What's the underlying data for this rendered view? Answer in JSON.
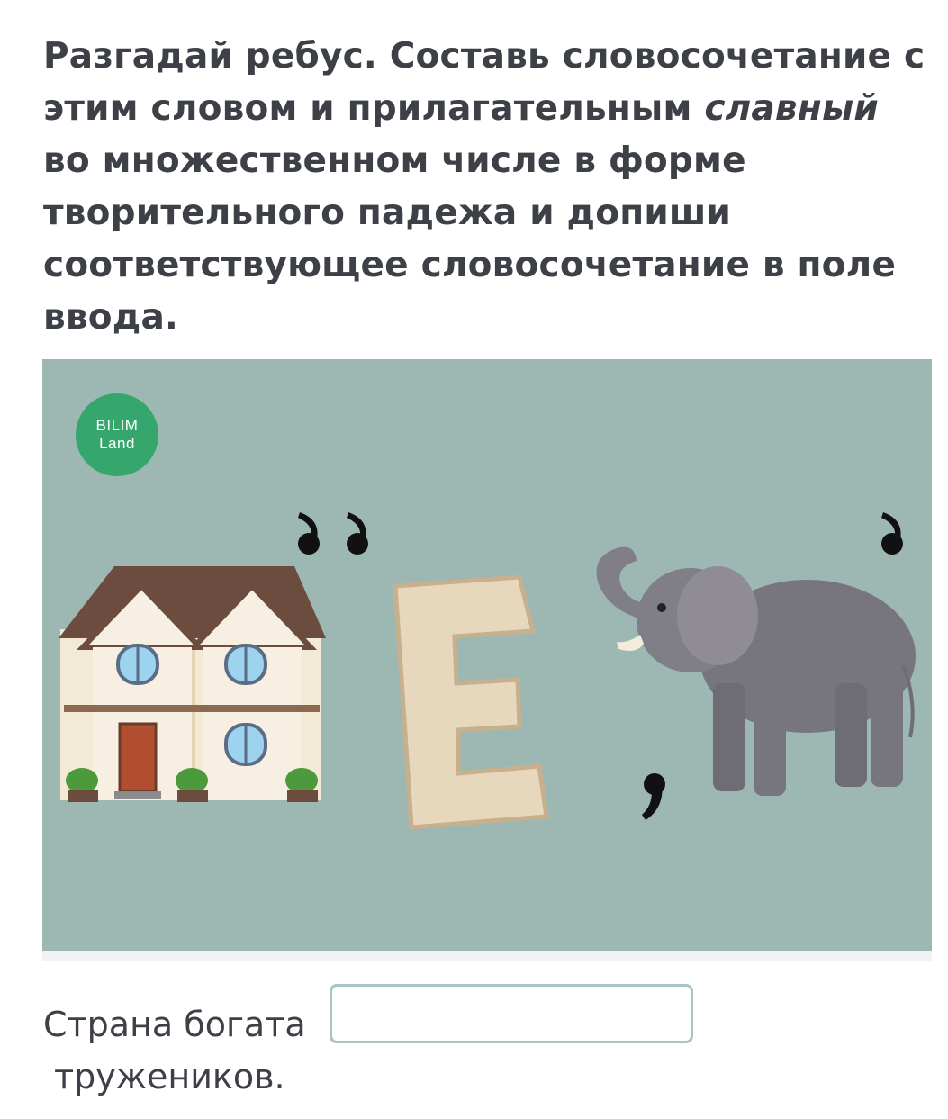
{
  "task": {
    "text_before": "Разгадай ребус. Составь словосочетание с этим словом и прилагательным ",
    "emphasis": "славный",
    "text_after": " во множественном числе в форме творительного падежа и допиши соответствующее словосочетание в поле ввода."
  },
  "rebus": {
    "logo_line1": "BILIM",
    "logo_line2": "Land",
    "letter": "Е",
    "pictures": [
      "house-icon",
      "letter-e",
      "elephant-icon"
    ],
    "background_color": "#9db8b3"
  },
  "answer": {
    "prefix": "Страна богата",
    "suffix": "тружеников.",
    "value": "",
    "placeholder": ""
  }
}
